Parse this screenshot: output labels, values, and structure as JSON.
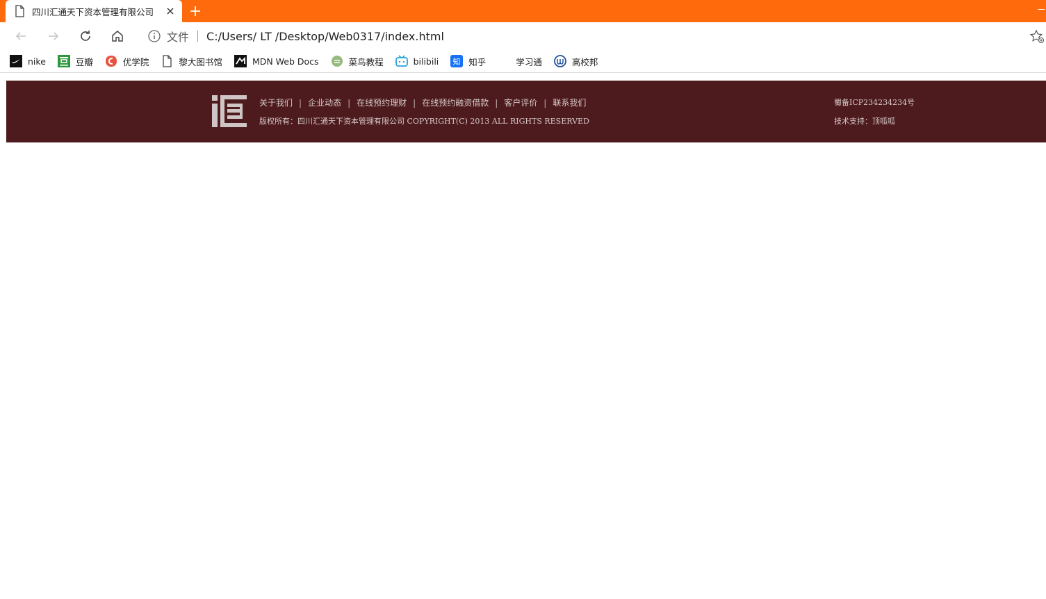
{
  "browser": {
    "tab_title": "四川汇通天下资本管理有限公司",
    "address_scheme": "文件",
    "url": "C:/Users/  LT /Desktop/Web0317/index.html",
    "accent_color": "#ff6a0c"
  },
  "bookmarks": [
    {
      "label": "nike",
      "icon": "nike-icon"
    },
    {
      "label": "豆瓣",
      "icon": "douban-icon"
    },
    {
      "label": "优学院",
      "icon": "youxueyuan-icon"
    },
    {
      "label": "黎大图书馆",
      "icon": "page-icon"
    },
    {
      "label": "MDN Web Docs",
      "icon": "mdn-icon"
    },
    {
      "label": "菜鸟教程",
      "icon": "runoob-icon"
    },
    {
      "label": "bilibili",
      "icon": "bilibili-icon"
    },
    {
      "label": "知乎",
      "icon": "zhihu-icon"
    },
    {
      "label": "学习通",
      "icon": "xuexitong-icon"
    },
    {
      "label": "高校邦",
      "icon": "gaoxiaobang-icon"
    }
  ],
  "footer": {
    "background": "#4d1b1e",
    "links": [
      "关于我们",
      "企业动态",
      "在线预约理财",
      "在线预约融资借款",
      "客户评价",
      "联系我们"
    ],
    "separator": "|",
    "copyright": "版权所有：四川汇通天下资本管理有限公司 COPYRIGHT(C) 2013 ALL RIGHTS RESERVED",
    "icp": "蜀备ICP234234234号",
    "support": "技术支持：顶呱呱"
  }
}
